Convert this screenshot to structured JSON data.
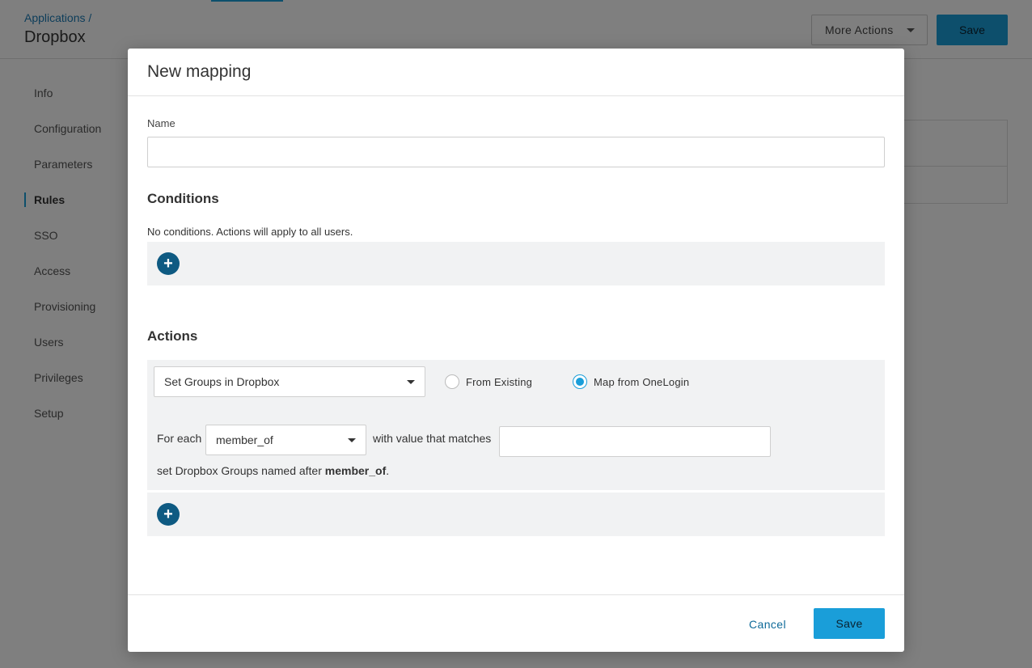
{
  "header": {
    "breadcrumb": "Applications /",
    "title": "Dropbox",
    "more_actions_label": "More Actions",
    "save_label": "Save"
  },
  "sidebar": {
    "items": [
      {
        "label": "Info"
      },
      {
        "label": "Configuration"
      },
      {
        "label": "Parameters"
      },
      {
        "label": "Rules",
        "active": true
      },
      {
        "label": "SSO"
      },
      {
        "label": "Access"
      },
      {
        "label": "Provisioning"
      },
      {
        "label": "Users"
      },
      {
        "label": "Privileges"
      },
      {
        "label": "Setup"
      }
    ]
  },
  "modal": {
    "title": "New mapping",
    "name_label": "Name",
    "name_value": "",
    "conditions_heading": "Conditions",
    "conditions_note": "No conditions. Actions will apply to all users.",
    "actions_heading": "Actions",
    "action": {
      "selected": "Set Groups in Dropbox",
      "radio_from_existing": "From Existing",
      "radio_map_from_onelogin": "Map from OneLogin",
      "selected_radio": "Map from OneLogin",
      "for_each_label": "For each",
      "attribute_selected": "member_of",
      "with_value_label": "with value that matches",
      "match_value": "",
      "result_prefix": "set Dropbox Groups named after ",
      "result_attribute": "member_of",
      "result_suffix": "."
    },
    "add_symbol": "+",
    "cancel_label": "Cancel",
    "save_label": "Save"
  },
  "colors": {
    "accent": "#1a9ed9",
    "add_button": "#0e5a82",
    "link": "#0e6a99",
    "panel": "#f1f2f3"
  }
}
